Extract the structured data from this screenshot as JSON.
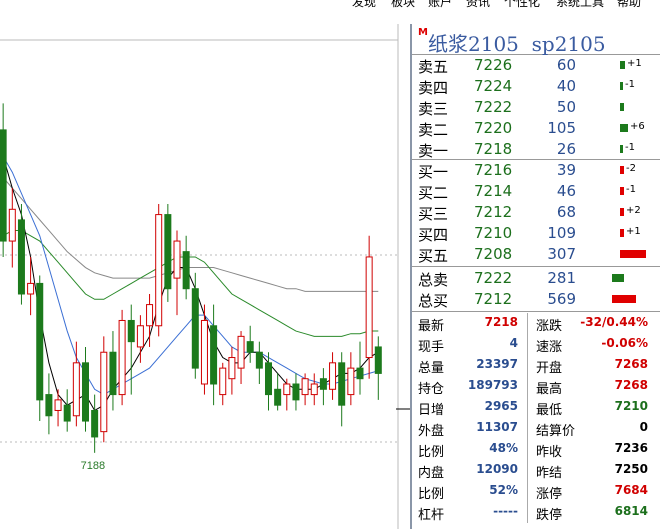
{
  "menu": [
    "发现",
    "板块",
    "账户",
    "资讯",
    "个性化",
    "系统工具",
    "帮助"
  ],
  "quote": {
    "mark": "M",
    "title": "纸浆2105",
    "code": "sp2105",
    "asks": [
      {
        "label": "卖五",
        "price": "7226",
        "vol": "60",
        "chg": "+1"
      },
      {
        "label": "卖四",
        "price": "7224",
        "vol": "40",
        "chg": "-1"
      },
      {
        "label": "卖三",
        "price": "7222",
        "vol": "50",
        "chg": ""
      },
      {
        "label": "卖二",
        "price": "7220",
        "vol": "105",
        "chg": "+6"
      },
      {
        "label": "卖一",
        "price": "7218",
        "vol": "26",
        "chg": "-1"
      }
    ],
    "bids": [
      {
        "label": "买一",
        "price": "7216",
        "vol": "39",
        "chg": "-2"
      },
      {
        "label": "买二",
        "price": "7214",
        "vol": "46",
        "chg": "-1"
      },
      {
        "label": "买三",
        "price": "7212",
        "vol": "68",
        "chg": "+2"
      },
      {
        "label": "买四",
        "price": "7210",
        "vol": "109",
        "chg": "+1"
      },
      {
        "label": "买五",
        "price": "7208",
        "vol": "307",
        "chg": ""
      }
    ],
    "totals": [
      {
        "label": "总卖",
        "price": "7222",
        "vol": "281"
      },
      {
        "label": "总买",
        "price": "7212",
        "vol": "569"
      }
    ],
    "stats": [
      {
        "l1": "最新",
        "v1": "7218",
        "l2": "涨跌",
        "v2": "-32/0.44%"
      },
      {
        "l1": "现手",
        "v1": "4",
        "l2": "速涨",
        "v2": "-0.06%"
      },
      {
        "l1": "总量",
        "v1": "23397",
        "l2": "开盘",
        "v2": "7268"
      },
      {
        "l1": "持仓",
        "v1": "189793",
        "l2": "最高",
        "v2": "7268"
      },
      {
        "l1": "日增",
        "v1": "2965",
        "l2": "最低",
        "v2": "7210"
      },
      {
        "l1": "外盘",
        "v1": "11307",
        "l2": "结算价",
        "v2": "0"
      },
      {
        "l1": "比例",
        "v1": "48%",
        "l2": "昨收",
        "v2": "7236"
      },
      {
        "l1": "内盘",
        "v1": "12090",
        "l2": "昨结",
        "v2": "7250"
      },
      {
        "l1": "比例",
        "v1": "52%",
        "l2": "涨停",
        "v2": "7684"
      },
      {
        "l1": "杠杆",
        "v1": "-----",
        "l2": "跌停",
        "v2": "6814"
      }
    ]
  },
  "chart": {
    "low_label": "7188",
    "colors": {
      "up": "#d00000",
      "down": "#1c7a1c",
      "ma1": "#000000",
      "ma2": "#3b6fd4",
      "ma3": "#2a8a2a",
      "ma4": "#888888"
    },
    "candles": [
      {
        "o": 7330,
        "h": 7335,
        "c": 7300,
        "l": 7290
      },
      {
        "o": 7310,
        "h": 7320,
        "c": 7268,
        "l": 7262
      },
      {
        "o": 7268,
        "h": 7288,
        "c": 7280,
        "l": 7258
      },
      {
        "o": 7276,
        "h": 7282,
        "c": 7248,
        "l": 7244
      },
      {
        "o": 7248,
        "h": 7262,
        "c": 7252,
        "l": 7240
      },
      {
        "o": 7252,
        "h": 7255,
        "c": 7208,
        "l": 7200
      },
      {
        "o": 7210,
        "h": 7218,
        "c": 7202,
        "l": 7195
      },
      {
        "o": 7204,
        "h": 7212,
        "c": 7208,
        "l": 7198
      },
      {
        "o": 7206,
        "h": 7212,
        "c": 7200,
        "l": 7196
      },
      {
        "o": 7202,
        "h": 7230,
        "c": 7222,
        "l": 7198
      },
      {
        "o": 7222,
        "h": 7228,
        "c": 7200,
        "l": 7196
      },
      {
        "o": 7204,
        "h": 7210,
        "c": 7194,
        "l": 7188
      },
      {
        "o": 7196,
        "h": 7232,
        "c": 7226,
        "l": 7192
      },
      {
        "o": 7226,
        "h": 7234,
        "c": 7210,
        "l": 7204
      },
      {
        "o": 7210,
        "h": 7242,
        "c": 7238,
        "l": 7206
      },
      {
        "o": 7238,
        "h": 7244,
        "c": 7230,
        "l": 7210
      },
      {
        "o": 7228,
        "h": 7240,
        "c": 7236,
        "l": 7222
      },
      {
        "o": 7236,
        "h": 7248,
        "c": 7244,
        "l": 7228
      },
      {
        "o": 7236,
        "h": 7282,
        "c": 7278,
        "l": 7232
      },
      {
        "o": 7278,
        "h": 7282,
        "c": 7250,
        "l": 7245
      },
      {
        "o": 7254,
        "h": 7272,
        "c": 7268,
        "l": 7240
      },
      {
        "o": 7264,
        "h": 7270,
        "c": 7250,
        "l": 7246
      },
      {
        "o": 7250,
        "h": 7256,
        "c": 7220,
        "l": 7216
      },
      {
        "o": 7214,
        "h": 7244,
        "c": 7238,
        "l": 7210
      },
      {
        "o": 7236,
        "h": 7244,
        "c": 7214,
        "l": 7206
      },
      {
        "o": 7210,
        "h": 7222,
        "c": 7220,
        "l": 7206
      },
      {
        "o": 7216,
        "h": 7228,
        "c": 7224,
        "l": 7210
      },
      {
        "o": 7220,
        "h": 7234,
        "c": 7232,
        "l": 7214
      },
      {
        "o": 7230,
        "h": 7236,
        "c": 7226,
        "l": 7222
      },
      {
        "o": 7226,
        "h": 7230,
        "c": 7220,
        "l": 7214
      },
      {
        "o": 7222,
        "h": 7226,
        "c": 7210,
        "l": 7204
      },
      {
        "o": 7212,
        "h": 7218,
        "c": 7206,
        "l": 7204
      },
      {
        "o": 7210,
        "h": 7216,
        "c": 7214,
        "l": 7204
      },
      {
        "o": 7214,
        "h": 7218,
        "c": 7208,
        "l": 7204
      },
      {
        "o": 7210,
        "h": 7218,
        "c": 7216,
        "l": 7206
      },
      {
        "o": 7210,
        "h": 7218,
        "c": 7214,
        "l": 7206
      },
      {
        "o": 7216,
        "h": 7220,
        "c": 7212,
        "l": 7206
      },
      {
        "o": 7212,
        "h": 7226,
        "c": 7222,
        "l": 7208
      },
      {
        "o": 7222,
        "h": 7226,
        "c": 7206,
        "l": 7198
      },
      {
        "o": 7210,
        "h": 7226,
        "c": 7220,
        "l": 7206
      },
      {
        "o": 7220,
        "h": 7230,
        "c": 7216,
        "l": 7210
      },
      {
        "o": 7224,
        "h": 7270,
        "c": 7262,
        "l": 7216
      },
      {
        "o": 7228,
        "h": 7232,
        "c": 7218,
        "l": 7208
      }
    ],
    "ma1": [
      7320,
      7300,
      7288,
      7278,
      7262,
      7240,
      7222,
      7210,
      7206,
      7208,
      7210,
      7204,
      7206,
      7212,
      7216,
      7220,
      7226,
      7232,
      7244,
      7254,
      7258,
      7258,
      7250,
      7240,
      7230,
      7224,
      7222,
      7222,
      7226,
      7226,
      7222,
      7218,
      7214,
      7212,
      7212,
      7212,
      7214,
      7216,
      7218,
      7218,
      7220,
      7224,
      7226
    ],
    "ma2": [
      7305,
      7300,
      7294,
      7286,
      7278,
      7270,
      7258,
      7246,
      7234,
      7224,
      7218,
      7212,
      7210,
      7212,
      7214,
      7216,
      7218,
      7220,
      7224,
      7228,
      7232,
      7236,
      7240,
      7240,
      7236,
      7232,
      7228,
      7226,
      7226,
      7226,
      7224,
      7222,
      7220,
      7218,
      7216,
      7215,
      7214,
      7214,
      7215,
      7216,
      7217,
      7218,
      7219
    ],
    "ma3": [
      7268,
      7270,
      7272,
      7272,
      7270,
      7268,
      7264,
      7260,
      7256,
      7252,
      7248,
      7246,
      7246,
      7248,
      7250,
      7252,
      7254,
      7256,
      7258,
      7260,
      7262,
      7262,
      7262,
      7260,
      7256,
      7252,
      7248,
      7246,
      7244,
      7242,
      7240,
      7238,
      7236,
      7234,
      7233,
      7232,
      7232,
      7232,
      7232,
      7233,
      7233,
      7234,
      7234
    ],
    "ma4": [
      7295,
      7292,
      7288,
      7284,
      7280,
      7276,
      7272,
      7268,
      7264,
      7261,
      7258,
      7256,
      7255,
      7254,
      7254,
      7254,
      7254,
      7254,
      7255,
      7256,
      7257,
      7258,
      7258,
      7258,
      7258,
      7257,
      7256,
      7255,
      7254,
      7253,
      7252,
      7251,
      7250,
      7250,
      7249,
      7249,
      7249,
      7249,
      7249,
      7249,
      7249,
      7249,
      7249
    ]
  }
}
